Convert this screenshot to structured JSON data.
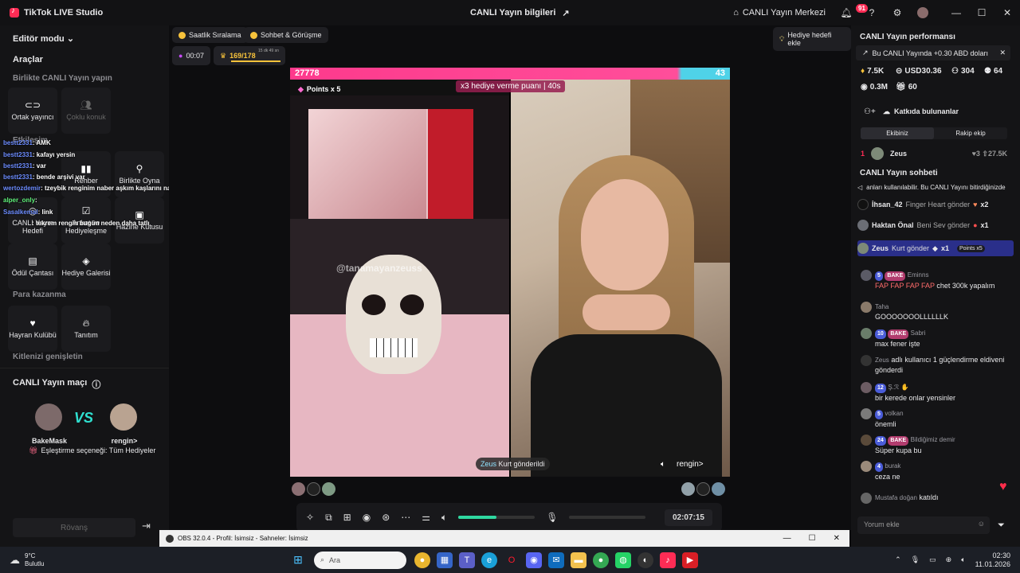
{
  "titlebar": {
    "app_name": "TikTok LIVE Studio",
    "center_title": "CANLI Yayın bilgileri",
    "live_center": "CANLI Yayın Merkezi",
    "notif_count": "91"
  },
  "left": {
    "mode": "Editör modu",
    "tools_title": "Araçlar",
    "section_together": "Birlikte CANLI Yayın yapın",
    "cohost": "Ortak yayıncı",
    "multi_guest": "Çoklu konuk",
    "section_interact": "Etkileşim",
    "guide": "Rehber",
    "play_together": "Birlikte Oyna",
    "live_goal": "CANLI Yayın Hedefi",
    "poll": "Anket ve Hediyeleşme",
    "treasure": "Hazine Kutusu",
    "reward_bag": "Ödül Çantası",
    "gift_gallery": "Hediye Galerisi",
    "section_earn": "Para kazanma",
    "fan_club": "Hayran Kulübü",
    "promo": "Tanıtım",
    "section_audience": "Kitlenizi genişletin",
    "match_title": "CANLI Yayın maçı",
    "player1": "BakeMask",
    "player2": "rengin>",
    "match_option": "Eşleştirme seçeneği: Tüm Hediyeler",
    "rematch": "Rövanş"
  },
  "overlay_chat": [
    {
      "user": "bestt2331",
      "text": ": AMK"
    },
    {
      "user": "bestt2331",
      "text": ": kafayı yersin"
    },
    {
      "user": "bestt2331",
      "text": ": var"
    },
    {
      "user": "bestt2331",
      "text": ": bende arşivi var"
    },
    {
      "user": "wertozdemir",
      "text": ": tzeybik renginim naber aşkım kaşlarını nasıl alıyorsun çok düzgün"
    },
    {
      "user": "alper_only",
      "text": ":"
    },
    {
      "user": "Sasalkemal",
      "text": ": link"
    },
    {
      "user": "",
      "text": ": tekrem rengin bugün neden daha tatlı"
    }
  ],
  "main": {
    "hourly_rank": "Saatlik Sıralama",
    "chat_call": "Sohbet & Görüşme",
    "gift_goal": "Hediye hedefi ekle",
    "elapsed": "00:07",
    "gift_progress": "169/178",
    "gift_timer": "15 dk 49 sn",
    "score_left": "27778",
    "score_right": "43",
    "points_badge": "Points x 5",
    "gift_multiplier": "x3 hediye verme puanı",
    "gift_multiplier_time": "40s",
    "sent_user": "Zeus",
    "sent_text": "Kurt gönderildi",
    "opponent_name": "rengin>",
    "watermark": "@tanamayanzeuss",
    "stream_time": "02:07:15",
    "volume_level": 0.5
  },
  "right": {
    "perf_title": "CANLI Yayın performansı",
    "perf_banner": "Bu CANLI Yayında +0.30 ABD doları",
    "stat_likes": "7.5K",
    "stat_usd": "USD30.36",
    "stat_viewers": "304",
    "stat_new": "64",
    "stat_views": "0.3M",
    "stat_gifts": "60",
    "contributors": "Katkıda bulunanlar",
    "tab_team": "Ekibiniz",
    "tab_rival": "Rakip ekip",
    "top_rank": "1",
    "top_name": "Zeus",
    "top_gifts": "3",
    "top_score": "27.5K",
    "chat_title": "CANLI Yayın sohbeti",
    "notice": "anları kullanılabilir. Bu CANLI Yayını bitirdiğinizde",
    "gift_rows": [
      {
        "user": "İhsan_42",
        "text": "Finger Heart gönder",
        "count": "x2"
      },
      {
        "user": "Haktan Önal",
        "text": "Beni Sev gönder",
        "count": "x1"
      },
      {
        "user": "Zeus",
        "text": "Kurt gönder",
        "count": "x1",
        "badge": "Points x5"
      }
    ],
    "comments": [
      {
        "lvl": "5",
        "tag": "BAKE",
        "name": "Eminns",
        "text": "chet 300k yapalım"
      },
      {
        "lvl": "",
        "tag": "",
        "name": "Taha",
        "text": "GOOOOOOOLLLLLLK"
      },
      {
        "lvl": "10",
        "tag": "BAKE",
        "name": "Sabri",
        "text": "max fener işte"
      },
      {
        "lvl": "",
        "tag": "",
        "name": "Zeus",
        "text": "adlı kullanıcı 1 güçlendirme eldiveni gönderdi"
      },
      {
        "lvl": "12",
        "tag": "",
        "name": "",
        "text": "bir kerede onlar yensinler"
      },
      {
        "lvl": "5",
        "tag": "",
        "name": "volkan",
        "text": "önemli"
      },
      {
        "lvl": "24",
        "tag": "BAKE",
        "name": "Bildiğimiz demir",
        "text": "Süper kupa bu"
      },
      {
        "lvl": "4",
        "tag": "",
        "name": "burak",
        "text": "ceza ne"
      }
    ],
    "joined_user": "Mustafa doğan",
    "joined_text": "katıldı",
    "comment_placeholder": "Yorum ekle"
  },
  "obs": {
    "title": "OBS 32.0.4 - Profil: İsimsiz - Sahneler: İsimsiz"
  },
  "taskbar": {
    "temp": "9°C",
    "weather": "Bulutlu",
    "search": "Ara",
    "time": "02:30",
    "date": "11.01.2026"
  }
}
